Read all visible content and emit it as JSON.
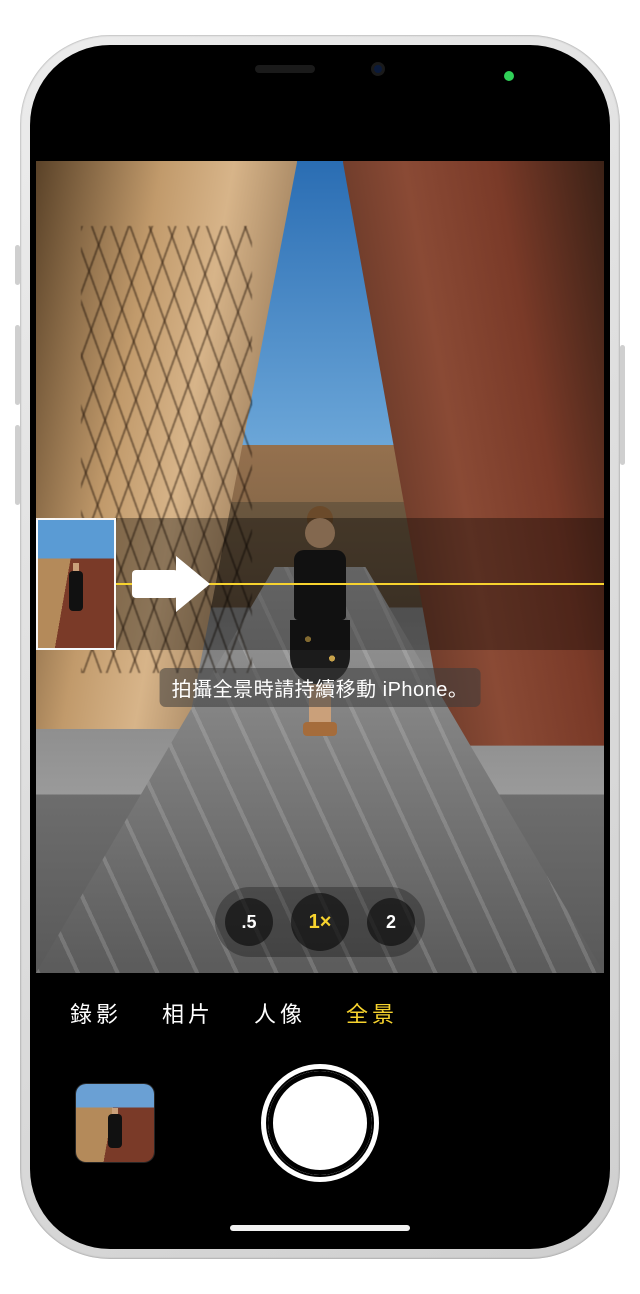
{
  "panorama": {
    "instruction": "拍攝全景時請持續移動 iPhone。"
  },
  "zoom": {
    "options": [
      ".5",
      "1×",
      "2"
    ],
    "active_index": 1
  },
  "modes": {
    "items": [
      "錄影",
      "相片",
      "人像",
      "全景"
    ],
    "active_index": 3
  },
  "colors": {
    "accent": "#f7d32e"
  }
}
